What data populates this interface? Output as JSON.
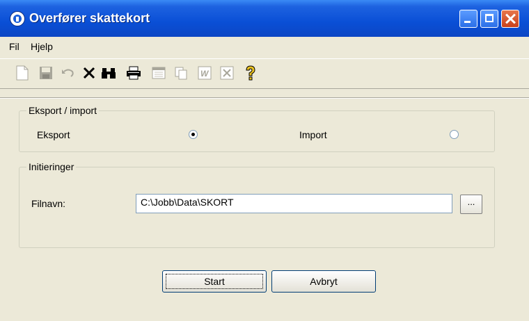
{
  "window": {
    "title": "Overfører skattekort"
  },
  "menu": [
    {
      "label": "Fil"
    },
    {
      "label": "Hjelp"
    }
  ],
  "toolbar": {
    "tools": [
      {
        "icon": "new-document-icon",
        "enabled": false
      },
      {
        "icon": "save-icon",
        "enabled": false
      },
      {
        "icon": "undo-icon",
        "enabled": false
      },
      {
        "icon": "delete-icon",
        "enabled": true
      },
      {
        "icon": "find-icon",
        "enabled": true
      },
      {
        "icon": "print-icon",
        "enabled": true
      },
      {
        "icon": "calendar-icon",
        "enabled": false
      },
      {
        "icon": "copy-icon",
        "enabled": false
      },
      {
        "icon": "word-icon",
        "enabled": false
      },
      {
        "icon": "excel-icon",
        "enabled": false
      },
      {
        "icon": "help-icon",
        "enabled": true
      }
    ]
  },
  "export_import": {
    "title": "Eksport / import",
    "export_label": "Eksport",
    "import_label": "Import",
    "selected": "Eksport"
  },
  "init": {
    "title": "Initieringer",
    "filename_label": "Filnavn:",
    "filename_value": "C:\\Jobb\\Data\\SKORT",
    "browse_label": "..."
  },
  "buttons": {
    "start_label": "Start",
    "cancel_label": "Avbryt"
  }
}
